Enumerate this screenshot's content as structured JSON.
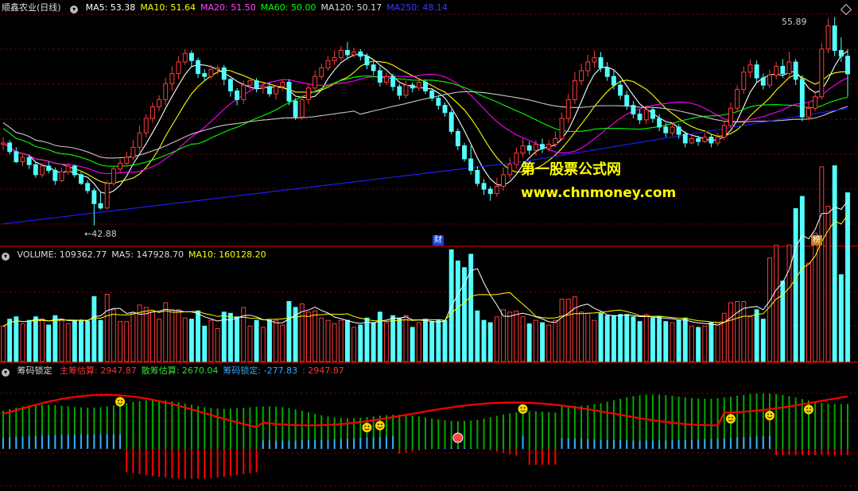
{
  "colors": {
    "background": "#000000",
    "grid": "#6a0000",
    "up": "#ff3c3c",
    "down": "#54ffff",
    "ma5": "#ffffff",
    "ma10": "#ffff00",
    "ma20": "#ff00ff",
    "ma60": "#00ff00",
    "ma120": "#c8c8c8",
    "ma250": "#2020ff",
    "main_chips": "#ff0000",
    "scattered_chips": "#00aa00",
    "lock_chips": "#33aaff"
  },
  "price_panel": {
    "stock_name": "顺鑫农业(日线)",
    "indicators": [
      {
        "label": "MA5: 53.38",
        "color": "#ffffff"
      },
      {
        "label": "MA10: 51.64",
        "color": "#ffff00"
      },
      {
        "label": "MA20: 51.50",
        "color": "#ff44ff"
      },
      {
        "label": "MA60: 50.00",
        "color": "#00ff00"
      },
      {
        "label": "MA120: 50.17",
        "color": "#dddddd"
      },
      {
        "label": "MA250: 48.14",
        "color": "#3a3aff"
      }
    ],
    "high_label": "55.89",
    "low_label": "42.88",
    "tag_cai": "财",
    "tag_bang": "榜",
    "watermark_cn": "第一股票公式网",
    "watermark_url": "www.chnmoney.com"
  },
  "volume_panel": {
    "indicators": [
      {
        "label": "VOLUME: 109362.77",
        "color": "#dddddd"
      },
      {
        "label": "MA5: 147928.70",
        "color": "#dddddd"
      },
      {
        "label": "MA10: 160128.20",
        "color": "#ffff00"
      }
    ]
  },
  "chip_panel": {
    "title": "筹码锁定",
    "indicators": [
      {
        "label": "主筹估算:",
        "value": "2947.87",
        "color": "#ff3333"
      },
      {
        "label": "散筹估算:",
        "value": "2670.04",
        "color": "#33dd33"
      },
      {
        "label": "筹码锁定:",
        "value": "-277.83",
        "color": "#33aaff"
      },
      {
        "label": ":",
        "value": "2947.87",
        "color": "#ff3333"
      }
    ]
  },
  "chart_data": {
    "type": "candlestick",
    "price_range": [
      42.0,
      57.5
    ],
    "candles": [
      [
        48.5,
        48.6,
        49.0,
        48.1
      ],
      [
        48.6,
        48.0,
        48.8,
        47.8
      ],
      [
        48.0,
        47.3,
        48.3,
        47.2
      ],
      [
        47.3,
        47.6,
        47.9,
        47.0
      ],
      [
        47.6,
        47.1,
        47.8,
        46.8
      ],
      [
        47.1,
        46.4,
        47.3,
        46.2
      ],
      [
        46.4,
        47.0,
        47.2,
        46.2
      ],
      [
        47.0,
        46.7,
        47.3,
        46.5
      ],
      [
        46.7,
        46.0,
        46.9,
        45.7
      ],
      [
        46.0,
        46.6,
        46.9,
        45.9
      ],
      [
        46.6,
        47.0,
        47.2,
        46.4
      ],
      [
        47.0,
        46.4,
        47.1,
        46.2
      ],
      [
        46.4,
        45.8,
        46.6,
        45.7
      ],
      [
        45.8,
        45.3,
        46.0,
        45.1
      ],
      [
        45.3,
        44.4,
        45.5,
        42.88
      ],
      [
        44.4,
        44.1,
        45.2,
        44.0
      ],
      [
        44.1,
        45.8,
        46.0,
        44.0
      ],
      [
        45.8,
        46.8,
        47.0,
        45.6
      ],
      [
        46.8,
        47.2,
        47.5,
        46.5
      ],
      [
        47.2,
        47.6,
        48.0,
        47.0
      ],
      [
        47.6,
        48.3,
        48.8,
        47.4
      ],
      [
        48.3,
        49.3,
        49.8,
        48.0
      ],
      [
        49.3,
        50.3,
        50.6,
        49.0
      ],
      [
        50.3,
        51.1,
        51.4,
        50.0
      ],
      [
        51.1,
        51.6,
        51.9,
        50.8
      ],
      [
        51.6,
        52.7,
        53.1,
        51.2
      ],
      [
        52.7,
        53.4,
        53.9,
        52.2
      ],
      [
        53.4,
        54.2,
        54.6,
        53.0
      ],
      [
        54.2,
        54.8,
        55.1,
        54.0
      ],
      [
        54.8,
        54.3,
        55.0,
        53.9
      ],
      [
        54.3,
        53.4,
        54.5,
        53.1
      ],
      [
        53.4,
        53.2,
        53.7,
        52.9
      ],
      [
        53.2,
        53.7,
        54.0,
        53.0
      ],
      [
        53.7,
        53.8,
        54.0,
        53.3
      ],
      [
        53.8,
        53.0,
        54.0,
        52.6
      ],
      [
        53.0,
        52.2,
        53.1,
        51.8
      ],
      [
        52.2,
        51.6,
        52.4,
        51.2
      ],
      [
        51.6,
        52.6,
        52.9,
        51.3
      ],
      [
        52.6,
        52.9,
        53.0,
        52.3
      ],
      [
        52.9,
        52.4,
        53.1,
        52.1
      ],
      [
        52.4,
        52.5,
        52.8,
        52.0
      ],
      [
        52.5,
        52.0,
        52.8,
        51.8
      ],
      [
        52.0,
        52.5,
        52.6,
        51.6
      ],
      [
        52.5,
        52.8,
        53.0,
        52.2
      ],
      [
        52.8,
        51.5,
        53.0,
        51.2
      ],
      [
        51.5,
        50.4,
        51.7,
        50.2
      ],
      [
        50.4,
        51.6,
        51.9,
        50.2
      ],
      [
        51.6,
        52.4,
        52.7,
        51.3
      ],
      [
        52.4,
        53.2,
        53.6,
        52.1
      ],
      [
        53.2,
        53.8,
        54.1,
        53.0
      ],
      [
        53.8,
        54.3,
        54.6,
        53.6
      ],
      [
        54.3,
        54.5,
        55.0,
        54.0
      ],
      [
        54.5,
        55.0,
        55.3,
        54.3
      ],
      [
        55.0,
        54.7,
        55.6,
        54.4
      ],
      [
        54.7,
        54.9,
        55.2,
        54.5
      ],
      [
        54.9,
        54.6,
        55.1,
        54.3
      ],
      [
        54.6,
        54.0,
        54.8,
        53.7
      ],
      [
        54.0,
        53.6,
        54.2,
        53.3
      ],
      [
        53.6,
        52.8,
        53.9,
        52.5
      ],
      [
        52.8,
        53.2,
        53.5,
        52.6
      ],
      [
        53.2,
        52.5,
        53.4,
        52.2
      ],
      [
        52.5,
        51.9,
        52.7,
        51.6
      ],
      [
        51.9,
        52.6,
        52.9,
        51.7
      ],
      [
        52.6,
        52.4,
        52.8,
        52.1
      ],
      [
        52.4,
        52.8,
        53.1,
        52.2
      ],
      [
        52.8,
        52.2,
        53.0,
        52.0
      ],
      [
        52.2,
        51.7,
        52.4,
        51.5
      ],
      [
        51.7,
        51.2,
        51.9,
        50.9
      ],
      [
        51.2,
        50.7,
        51.4,
        50.4
      ],
      [
        50.7,
        49.4,
        50.9,
        49.2
      ],
      [
        49.4,
        48.4,
        49.6,
        48.1
      ],
      [
        48.4,
        47.5,
        48.6,
        47.3
      ],
      [
        47.5,
        46.7,
        48.4,
        46.4
      ],
      [
        46.7,
        45.8,
        47.0,
        45.6
      ],
      [
        45.8,
        45.4,
        46.1,
        45.0
      ],
      [
        45.4,
        45.1,
        45.6,
        44.6
      ],
      [
        45.1,
        45.6,
        46.2,
        44.9
      ],
      [
        45.6,
        46.4,
        46.9,
        45.3
      ],
      [
        46.4,
        47.1,
        47.6,
        46.1
      ],
      [
        47.1,
        47.9,
        48.3,
        46.8
      ],
      [
        47.9,
        48.4,
        48.9,
        47.6
      ],
      [
        48.4,
        48.1,
        48.7,
        47.8
      ],
      [
        48.1,
        48.5,
        48.8,
        47.7
      ],
      [
        48.5,
        48.2,
        48.9,
        47.9
      ],
      [
        48.2,
        48.5,
        48.8,
        48.0
      ],
      [
        48.5,
        48.9,
        49.4,
        48.3
      ],
      [
        48.9,
        50.3,
        50.7,
        48.8
      ],
      [
        50.3,
        51.6,
        52.0,
        50.0
      ],
      [
        51.6,
        52.9,
        53.5,
        51.3
      ],
      [
        52.9,
        53.6,
        54.1,
        52.6
      ],
      [
        53.6,
        54.2,
        54.7,
        53.2
      ],
      [
        54.2,
        54.5,
        55.0,
        53.8
      ],
      [
        54.5,
        53.8,
        54.9,
        53.5
      ],
      [
        53.8,
        53.2,
        54.2,
        52.9
      ],
      [
        53.2,
        52.6,
        53.6,
        52.3
      ],
      [
        52.6,
        51.9,
        52.9,
        51.6
      ],
      [
        51.9,
        51.2,
        52.2,
        50.9
      ],
      [
        51.2,
        50.6,
        51.5,
        50.3
      ],
      [
        50.6,
        50.2,
        50.9,
        49.9
      ],
      [
        50.2,
        50.9,
        51.2,
        49.9
      ],
      [
        50.9,
        50.3,
        51.1,
        50.0
      ],
      [
        50.3,
        49.7,
        50.6,
        49.4
      ],
      [
        49.7,
        49.3,
        50.0,
        49.0
      ],
      [
        49.3,
        49.7,
        50.0,
        49.1
      ],
      [
        49.7,
        49.2,
        49.9,
        48.9
      ],
      [
        49.2,
        48.6,
        49.4,
        48.3
      ],
      [
        48.6,
        48.9,
        49.2,
        48.5
      ],
      [
        48.9,
        48.7,
        49.1,
        48.4
      ],
      [
        48.7,
        49.0,
        49.3,
        48.6
      ],
      [
        49.0,
        48.6,
        49.2,
        48.3
      ],
      [
        48.6,
        49.0,
        49.3,
        48.4
      ],
      [
        49.0,
        49.8,
        50.1,
        48.8
      ],
      [
        49.8,
        51.0,
        51.4,
        49.6
      ],
      [
        51.0,
        52.3,
        52.6,
        50.8
      ],
      [
        52.3,
        53.5,
        53.9,
        52.0
      ],
      [
        53.5,
        54.0,
        54.4,
        53.1
      ],
      [
        54.0,
        53.1,
        54.3,
        52.8
      ],
      [
        53.1,
        52.6,
        53.4,
        52.3
      ],
      [
        52.6,
        53.3,
        53.7,
        52.4
      ],
      [
        53.3,
        53.9,
        54.2,
        53.0
      ],
      [
        53.9,
        53.4,
        54.4,
        53.1
      ],
      [
        53.4,
        54.2,
        54.9,
        53.2
      ],
      [
        54.2,
        53.0,
        54.4,
        52.6
      ],
      [
        53.0,
        50.4,
        53.3,
        50.1
      ],
      [
        50.4,
        51.0,
        51.4,
        50.2
      ],
      [
        51.0,
        51.8,
        52.2,
        50.8
      ],
      [
        51.8,
        55.1,
        55.5,
        51.6
      ],
      [
        55.1,
        56.7,
        57.2,
        54.8
      ],
      [
        56.7,
        55.0,
        57.3,
        54.6
      ],
      [
        55.0,
        54.6,
        55.9,
        54.2
      ],
      [
        54.6,
        53.38,
        55.1,
        51.8
      ]
    ],
    "ma_series": [
      "MA5",
      "MA10",
      "MA20",
      "MA60",
      "MA120",
      "MA250"
    ],
    "volume_ma_series": [
      "MA5",
      "MA10"
    ]
  }
}
